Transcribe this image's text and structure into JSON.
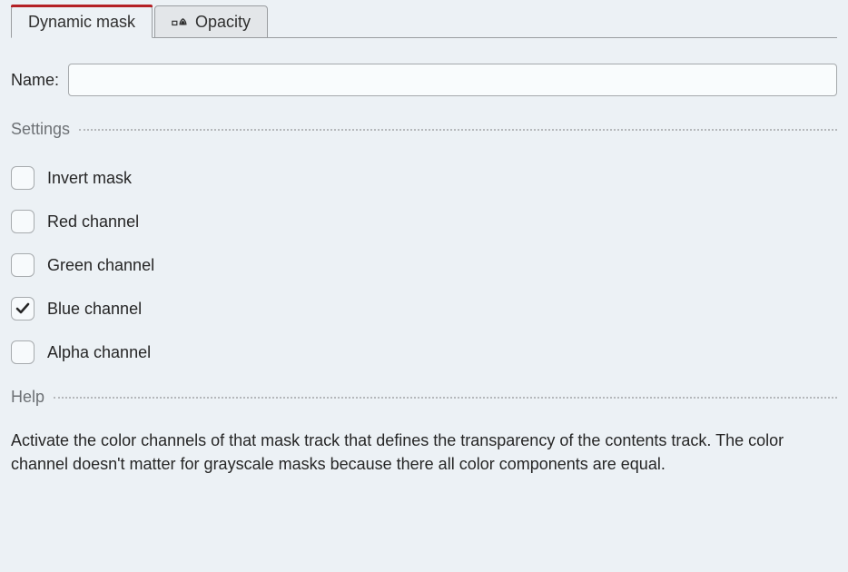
{
  "tabs": {
    "dynamic_mask": {
      "label": "Dynamic mask",
      "active": true
    },
    "opacity": {
      "label": "Opacity",
      "active": false
    }
  },
  "name_field": {
    "label": "Name:",
    "value": ""
  },
  "sections": {
    "settings_title": "Settings",
    "help_title": "Help"
  },
  "checkboxes": {
    "invert_mask": {
      "label": "Invert mask",
      "checked": false
    },
    "red_channel": {
      "label": "Red channel",
      "checked": false
    },
    "green_channel": {
      "label": "Green channel",
      "checked": false
    },
    "blue_channel": {
      "label": "Blue channel",
      "checked": true
    },
    "alpha_channel": {
      "label": "Alpha channel",
      "checked": false
    }
  },
  "help_text": "Activate the color channels of that mask track that defines the transparency of the contents track. The color channel doesn't matter for grayscale masks because there all color components are equal."
}
